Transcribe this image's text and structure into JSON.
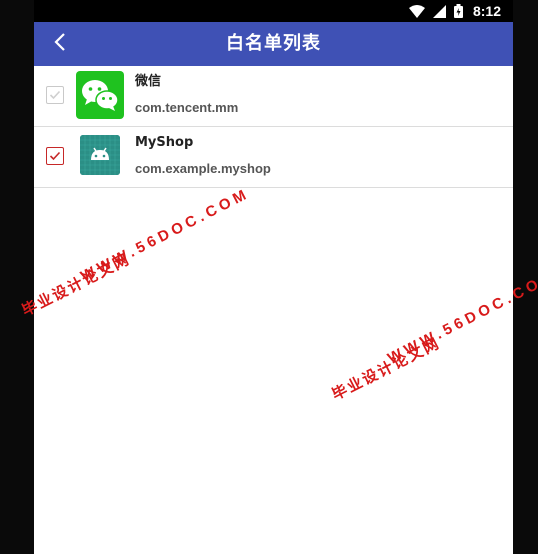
{
  "status_bar": {
    "time": "8:12",
    "icons": [
      "wifi-icon",
      "signal-icon",
      "battery-icon"
    ]
  },
  "app_bar": {
    "title": "白名单列表",
    "back_icon": "chevron-left-icon",
    "color": "#3f51b5"
  },
  "list": {
    "items": [
      {
        "name": "微信",
        "package": "com.tencent.mm",
        "checked": false,
        "icon": "wechat-icon"
      },
      {
        "name": "MyShop",
        "package": "com.example.myshop",
        "checked": true,
        "icon": "android-icon"
      }
    ]
  },
  "watermark": {
    "url": "WWW.56DOC.COM",
    "cn": "毕业设计论文网",
    "color": "#d81b1b"
  }
}
